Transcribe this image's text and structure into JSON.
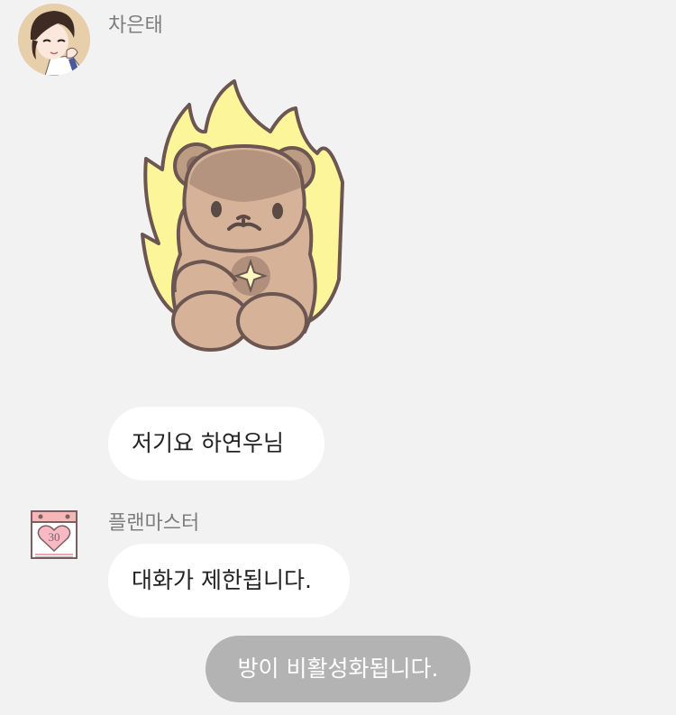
{
  "messages": [
    {
      "sender": "차은태",
      "avatar_icon": "anime-boy-avatar-icon",
      "sticker_icon": "flaming-bear-sticker-icon",
      "text": "저기요 하연우님"
    },
    {
      "sender": "플랜마스터",
      "avatar_icon": "calendar-heart-icon",
      "calendar_day": "30",
      "text": "대화가 제한됩니다."
    }
  ],
  "system_notice": "방이 비활성화됩니다.",
  "colors": {
    "background": "#f2f2f2",
    "bubble": "#ffffff",
    "system_pill": "#b3b3b3",
    "sender_name": "#7d7d7d"
  }
}
